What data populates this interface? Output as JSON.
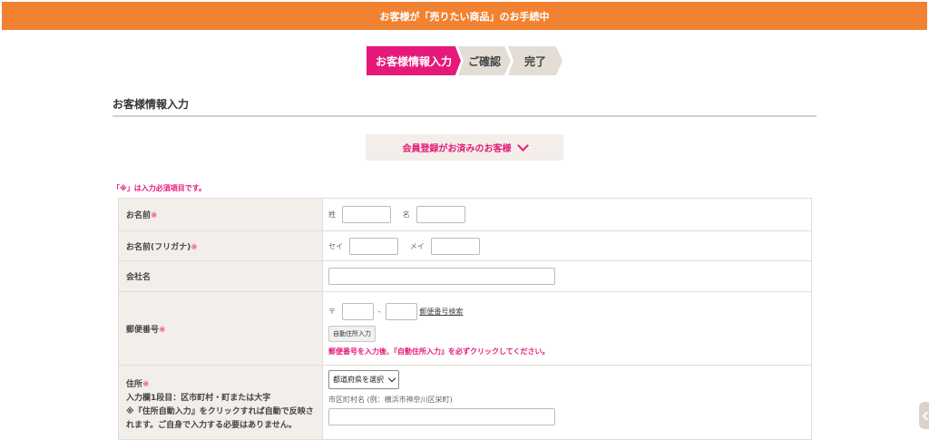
{
  "banner": {
    "prefix": "お客様が「",
    "highlight": "売りたい商品",
    "suffix": "」のお手続中"
  },
  "steps": [
    {
      "label": "お客様情報入力",
      "active": true
    },
    {
      "label": "ご確認",
      "active": false
    },
    {
      "label": "完了",
      "active": false
    }
  ],
  "section": {
    "title": "お客様情報入力"
  },
  "member_button": {
    "label": "会員登録がお済みのお客様"
  },
  "required_note": "「※」は入力必須項目です。",
  "required_mark": "※",
  "form": {
    "name": {
      "label": "お名前",
      "last_label": "姓",
      "first_label": "名"
    },
    "kana": {
      "label": "お名前(フリガナ)",
      "last_label": "セイ",
      "first_label": "メイ"
    },
    "company": {
      "label": "会社名"
    },
    "postal": {
      "label": "郵便番号",
      "prefix": "〒",
      "separator": "-",
      "search_link": "郵便番号検索",
      "auto_button": "自動住所入力",
      "note": "郵便番号を入力後、『自動住所入力』を必ずクリックしてください。"
    },
    "address": {
      "label": "住所",
      "line1": "入力欄1段目：区市町村・町または大字",
      "line2": "※『住所自動入力』をクリックすれば自動で反映されます。ご自身で入力する必要はありません。",
      "prefecture_selected": "都道府県を選択",
      "city_hint": "市区町村名 (例：横浜市神奈川区栄町)"
    }
  },
  "colors": {
    "accent": "#e6197a",
    "banner": "#f08232",
    "label_bg": "#f2efeb"
  }
}
